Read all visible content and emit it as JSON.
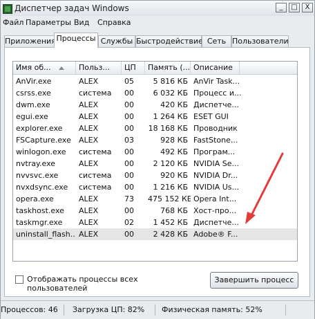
{
  "window": {
    "title": "Диспетчер задач Windows",
    "buttons": {
      "minimize": "_",
      "maximize": "□",
      "close": "X"
    }
  },
  "menu": [
    "Файл",
    "Параметры",
    "Вид",
    "Справка"
  ],
  "tabs": [
    "Приложения",
    "Процессы",
    "Службы",
    "Быстродействие",
    "Сеть",
    "Пользователи"
  ],
  "active_tab": "Процессы",
  "table": {
    "headers": [
      "Имя об...",
      "Польз...",
      "ЦП",
      "Память (...",
      "Описание"
    ],
    "sort_icon": "sort-ascending-icon",
    "rows": [
      {
        "name": "AnVir.exe",
        "user": "ALEX",
        "cpu": "05",
        "memory": "5 816 КБ",
        "description": "AnVir Task..."
      },
      {
        "name": "csrss.exe",
        "user": "система",
        "cpu": "00",
        "memory": "6 032 КБ",
        "description": "Процесс и..."
      },
      {
        "name": "dwm.exe",
        "user": "ALEX",
        "cpu": "00",
        "memory": "420 КБ",
        "description": "Диспетче..."
      },
      {
        "name": "egui.exe",
        "user": "ALEX",
        "cpu": "00",
        "memory": "1 264 КБ",
        "description": "ESET GUI"
      },
      {
        "name": "explorer.exe",
        "user": "ALEX",
        "cpu": "00",
        "memory": "18 168 КБ",
        "description": "Проводник"
      },
      {
        "name": "FSCapture.exe",
        "user": "ALEX",
        "cpu": "03",
        "memory": "928 КБ",
        "description": "FastStone..."
      },
      {
        "name": "winlogon.exe",
        "user": "система",
        "cpu": "00",
        "memory": "492 КБ",
        "description": "Програм..."
      },
      {
        "name": "nvtray.exe",
        "user": "ALEX",
        "cpu": "00",
        "memory": "2 120 КБ",
        "description": "NVIDIA Se..."
      },
      {
        "name": "nvvsvc.exe",
        "user": "система",
        "cpu": "00",
        "memory": "920 КБ",
        "description": "NVIDIA Dr..."
      },
      {
        "name": "nvxdsync.exe",
        "user": "система",
        "cpu": "00",
        "memory": "1 216 КБ",
        "description": "NVIDIA Us..."
      },
      {
        "name": "opera.exe",
        "user": "ALEX",
        "cpu": "73",
        "memory": "475 152 КБ",
        "description": "Opera Int..."
      },
      {
        "name": "taskhost.exe",
        "user": "ALEX",
        "cpu": "00",
        "memory": "768 КБ",
        "description": "Хост-про..."
      },
      {
        "name": "taskmgr.exe",
        "user": "ALEX",
        "cpu": "02",
        "memory": "1 452 КБ",
        "description": "Диспетче..."
      },
      {
        "name": "uninstall_flash...",
        "user": "ALEX",
        "cpu": "00",
        "memory": "2 428 КБ",
        "description": "Adobe® F..."
      }
    ]
  },
  "checkbox": {
    "label": "Отображать процессы всех пользователей"
  },
  "end_button": "Завершить процесс",
  "status": {
    "processes": "Процессов: 46",
    "cpu": "Загрузка ЦП: 82%",
    "memory": "Физическая память: 52%"
  },
  "colors": {
    "annotation_arrow": "#e53a3a"
  }
}
